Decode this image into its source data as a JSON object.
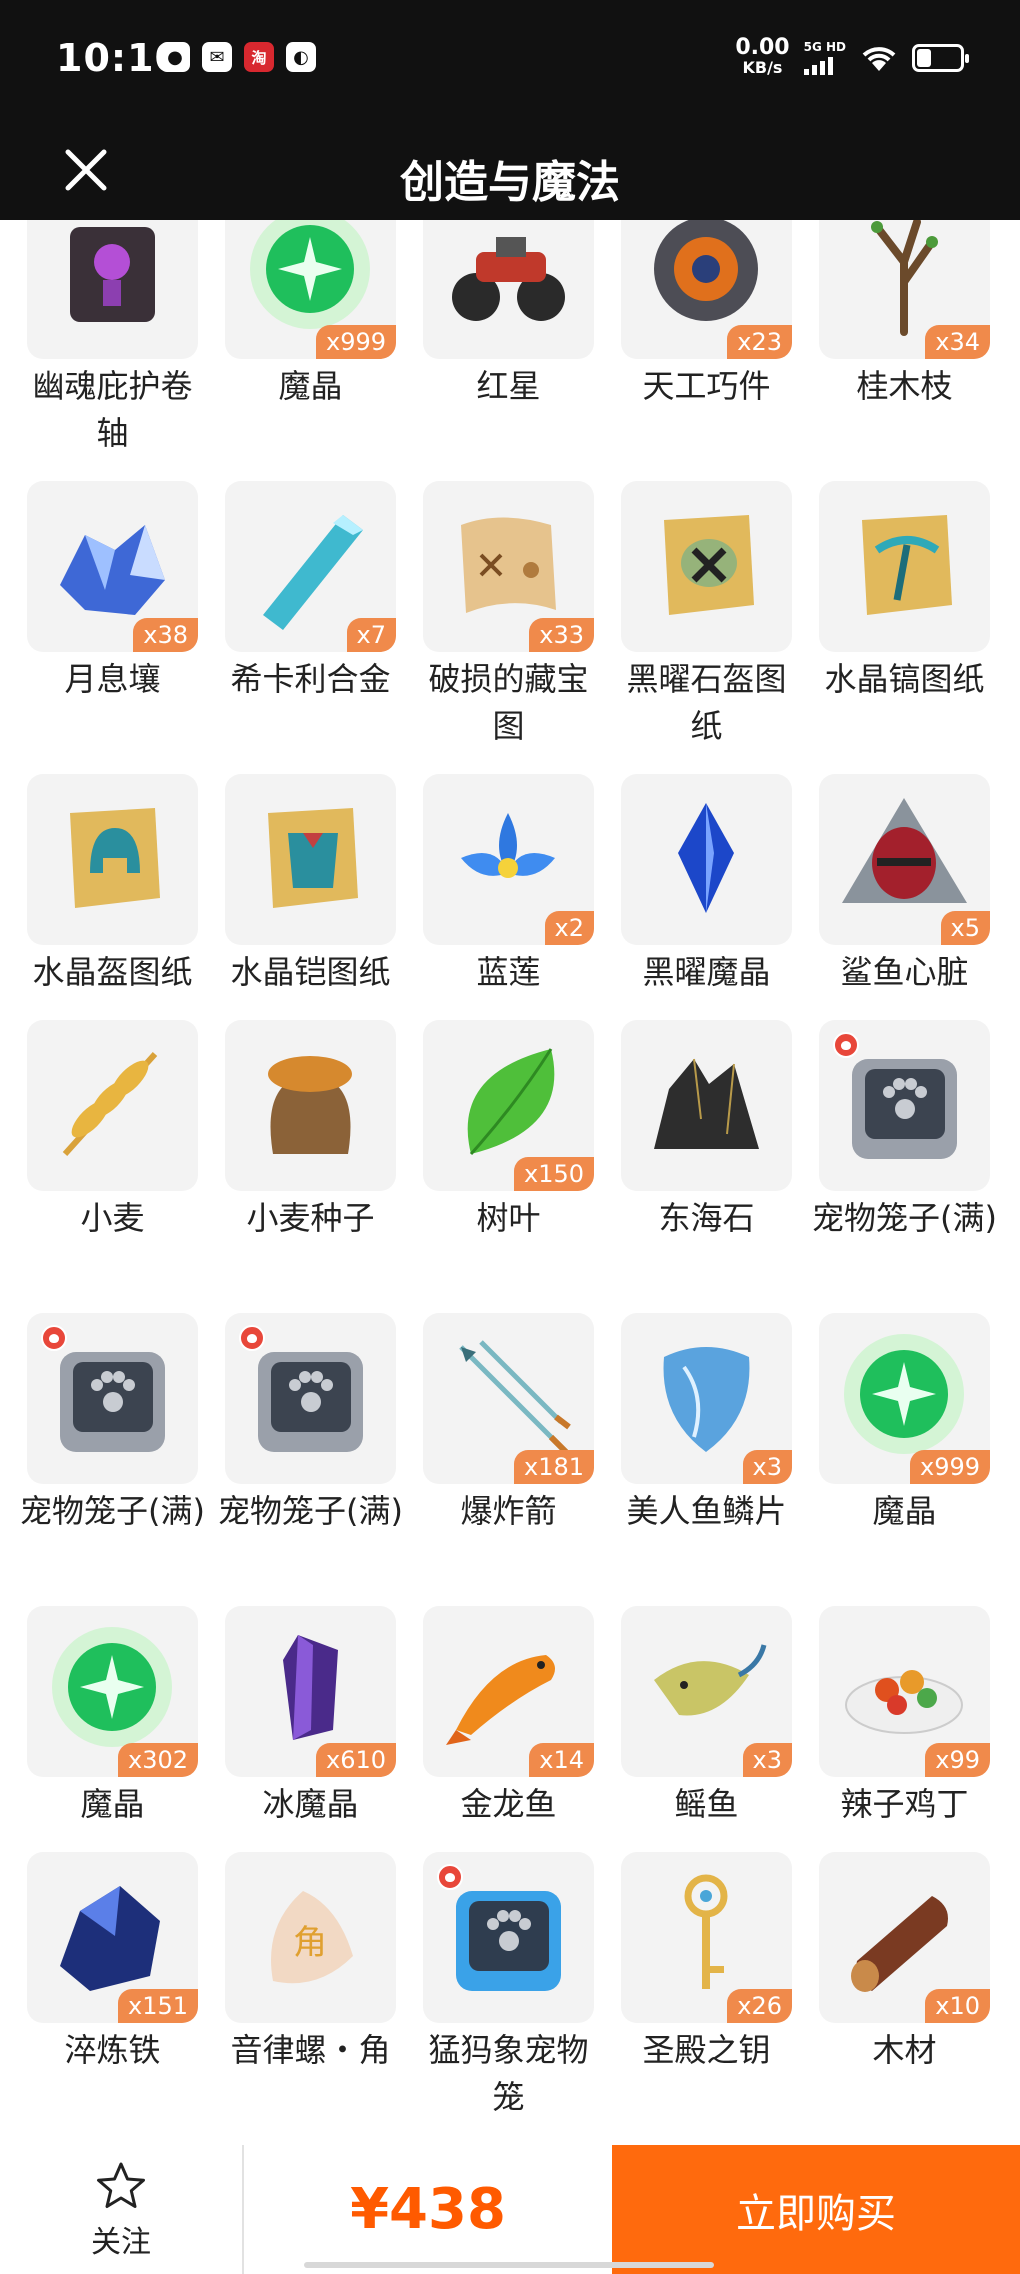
{
  "status_bar": {
    "time": "10:10",
    "net_speed": "0.00",
    "net_unit": "KB/s",
    "signal_label": "5G HD",
    "app_icons": [
      "wechat-icon",
      "message-icon",
      "taobao-icon",
      "app-icon"
    ]
  },
  "header": {
    "title": "创造与魔法"
  },
  "items": [
    {
      "name": "幽魂庇护卷轴",
      "qty": "",
      "icon": "scroll-icon"
    },
    {
      "name": "魔晶",
      "qty": "x999",
      "icon": "green-orb-icon"
    },
    {
      "name": "红星",
      "qty": "",
      "icon": "motorcycle-icon"
    },
    {
      "name": "天工巧件",
      "qty": "x23",
      "icon": "gear-icon"
    },
    {
      "name": "桂木枝",
      "qty": "x34",
      "icon": "branch-icon"
    },
    {
      "name": "月息壤",
      "qty": "x38",
      "icon": "blue-crystal-pile-icon"
    },
    {
      "name": "希卡利合金",
      "qty": "x7",
      "icon": "crystal-bar-icon"
    },
    {
      "name": "破损的藏宝图",
      "qty": "x33",
      "icon": "treasure-map-icon"
    },
    {
      "name": "黑曜石盔图纸",
      "qty": "",
      "icon": "blueprint-scroll-icon"
    },
    {
      "name": "水晶镐图纸",
      "qty": "",
      "icon": "pickaxe-scroll-icon"
    },
    {
      "name": "水晶盔图纸",
      "qty": "",
      "icon": "helmet-scroll-icon"
    },
    {
      "name": "水晶铠图纸",
      "qty": "",
      "icon": "armor-scroll-icon"
    },
    {
      "name": "蓝莲",
      "qty": "x2",
      "icon": "blue-lotus-icon"
    },
    {
      "name": "黑曜魔晶",
      "qty": "",
      "icon": "blue-shard-icon"
    },
    {
      "name": "鲨鱼心脏",
      "qty": "x5",
      "icon": "shark-heart-icon"
    },
    {
      "name": "小麦",
      "qty": "",
      "icon": "wheat-icon"
    },
    {
      "name": "小麦种子",
      "qty": "",
      "icon": "seed-bag-icon"
    },
    {
      "name": "树叶",
      "qty": "x150",
      "icon": "leaf-icon"
    },
    {
      "name": "东海石",
      "qty": "",
      "icon": "black-rock-icon"
    },
    {
      "name": "宠物笼子(满)",
      "qty": "",
      "icon": "pet-cage-icon",
      "paw": true
    },
    {
      "name": "宠物笼子(满)",
      "qty": "",
      "icon": "pet-cage-icon",
      "paw": true
    },
    {
      "name": "宠物笼子(满)",
      "qty": "",
      "icon": "pet-cage-icon",
      "paw": true
    },
    {
      "name": "爆炸箭",
      "qty": "x181",
      "icon": "arrows-icon"
    },
    {
      "name": "美人鱼鳞片",
      "qty": "x3",
      "icon": "scale-icon"
    },
    {
      "name": "魔晶",
      "qty": "x999",
      "icon": "green-orb-icon"
    },
    {
      "name": "魔晶",
      "qty": "x302",
      "icon": "green-orb-icon"
    },
    {
      "name": "冰魔晶",
      "qty": "x610",
      "icon": "purple-crystal-icon"
    },
    {
      "name": "金龙鱼",
      "qty": "x14",
      "icon": "goldfish-icon"
    },
    {
      "name": "鳐鱼",
      "qty": "x3",
      "icon": "ray-fish-icon"
    },
    {
      "name": "辣子鸡丁",
      "qty": "x99",
      "icon": "dish-icon"
    },
    {
      "name": "淬炼铁",
      "qty": "x151",
      "icon": "blue-ore-icon"
    },
    {
      "name": "音律螺・角",
      "qty": "",
      "icon": "conch-icon"
    },
    {
      "name": "猛犸象宠物笼",
      "qty": "",
      "icon": "blue-pet-cage-icon",
      "paw": true
    },
    {
      "name": "圣殿之钥",
      "qty": "x26",
      "icon": "key-icon"
    },
    {
      "name": "木材",
      "qty": "x10",
      "icon": "log-icon"
    },
    {
      "name": "",
      "qty": "",
      "icon": "partial-icon"
    },
    {
      "name": "",
      "qty": "",
      "icon": "partial-icon"
    },
    {
      "name": "",
      "qty": "",
      "icon": "partial-icon"
    },
    {
      "name": "",
      "qty": "",
      "icon": "partial-icon"
    },
    {
      "name": "",
      "qty": "",
      "icon": "partial-icon"
    }
  ],
  "bottom_bar": {
    "follow_label": "关注",
    "price": "¥438",
    "buy_label": "立即购买"
  },
  "colors": {
    "accent": "#ff6a0d",
    "qty_badge": "#f08a4b",
    "price": "#ff5a00",
    "header_bg": "#111111"
  }
}
